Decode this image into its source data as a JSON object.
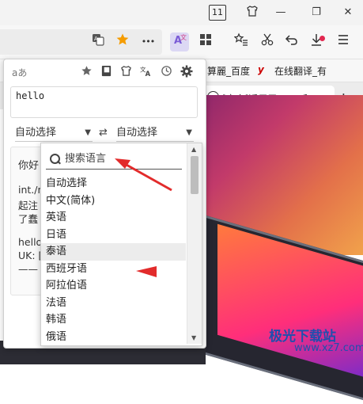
{
  "titlebar": {
    "tab_count": "11",
    "minimize": "—",
    "restore": "❐",
    "close": "✕"
  },
  "toolbar": {
    "bookmark_star_color": "#f59c00",
    "more": "•••"
  },
  "bookmarks": {
    "item1": "算麗_百度",
    "item2": "在线翻译_有"
  },
  "tab": {
    "title": "[官方]适用于 Mac 和",
    "new_tab": "+"
  },
  "popup": {
    "logo": "aあ",
    "source_text": "hello",
    "source_lang": "自动选择",
    "target_lang": "自动选择",
    "swap": "⇄",
    "result_lines": [
      "你好",
      "int./n.",
      "起注",
      "了蠢",
      "hello",
      "UK: [",
      "——"
    ]
  },
  "dropdown": {
    "close": "✕",
    "search_placeholder": "搜索语言",
    "languages": [
      "自动选择",
      "中文(简体)",
      "英语",
      "日语",
      "泰语",
      "西班牙语",
      "阿拉伯语",
      "法语",
      "韩语",
      "俄语"
    ],
    "hover_index": 4
  },
  "watermark": {
    "name": "极光下载站",
    "url": "www.xz7.com"
  },
  "colors": {
    "accent": "#7b5cd6",
    "annotation_arrow": "#e22b2b",
    "watermark": "#1f4fae"
  }
}
